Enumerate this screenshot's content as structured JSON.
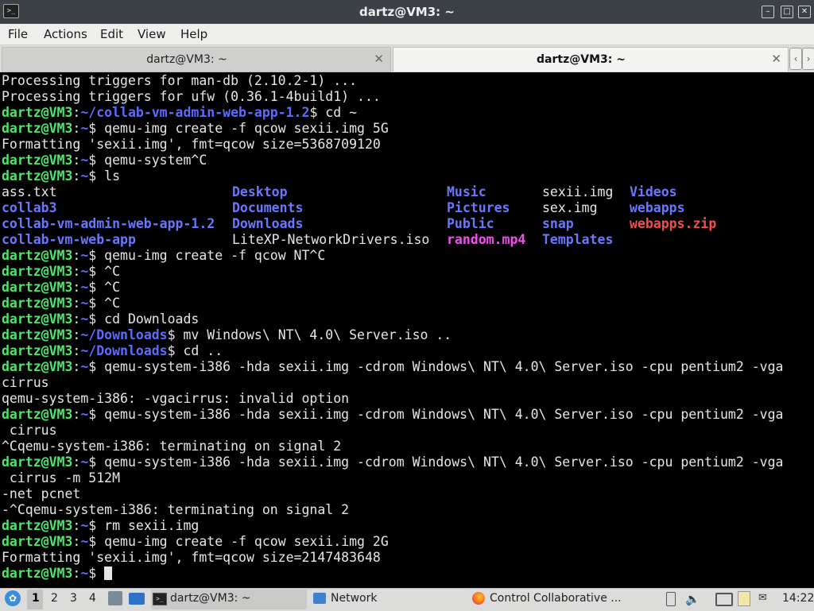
{
  "window": {
    "title": "dartz@VM3: ~",
    "icon": "terminal-icon",
    "controls": [
      "minimize-icon",
      "maximize-icon",
      "close-icon"
    ]
  },
  "menu": [
    "File",
    "Actions",
    "Edit",
    "View",
    "Help"
  ],
  "tabs": [
    {
      "label": "dartz@VM3: ~",
      "active": false
    },
    {
      "label": "dartz@VM3: ~",
      "active": true
    }
  ],
  "terminal": {
    "lines": [
      {
        "segs": [
          {
            "t": "Processing triggers for man-db (2.10.2-1) ...",
            "c": "plain"
          }
        ]
      },
      {
        "segs": [
          {
            "t": "Processing triggers for ufw (0.36.1-4build1) ...",
            "c": "plain"
          }
        ]
      },
      {
        "segs": [
          {
            "t": "dartz@VM3",
            "c": "user"
          },
          {
            "t": ":",
            "c": "plain"
          },
          {
            "t": "~/collab-vm-admin-web-app-1.2",
            "c": "path"
          },
          {
            "t": "$ cd ~",
            "c": "plain"
          }
        ]
      },
      {
        "segs": [
          {
            "t": "dartz@VM3",
            "c": "user"
          },
          {
            "t": ":",
            "c": "plain"
          },
          {
            "t": "~",
            "c": "path"
          },
          {
            "t": "$ qemu-img create -f qcow sexii.img 5G",
            "c": "plain"
          }
        ]
      },
      {
        "segs": [
          {
            "t": "Formatting 'sexii.img', fmt=qcow size=5368709120",
            "c": "plain"
          }
        ]
      },
      {
        "segs": [
          {
            "t": "dartz@VM3",
            "c": "user"
          },
          {
            "t": ":",
            "c": "plain"
          },
          {
            "t": "~",
            "c": "path"
          },
          {
            "t": "$ qemu-system^C",
            "c": "plain"
          }
        ]
      },
      {
        "segs": [
          {
            "t": "dartz@VM3",
            "c": "user"
          },
          {
            "t": ":",
            "c": "plain"
          },
          {
            "t": "~",
            "c": "path"
          },
          {
            "t": "$ ls",
            "c": "plain"
          }
        ]
      },
      {
        "ls": true
      },
      {
        "ls": true
      },
      {
        "ls": true
      },
      {
        "ls": true
      },
      {
        "segs": [
          {
            "t": "dartz@VM3",
            "c": "user"
          },
          {
            "t": ":",
            "c": "plain"
          },
          {
            "t": "~",
            "c": "path"
          },
          {
            "t": "$ qemu-img create -f qcow NT^C",
            "c": "plain"
          }
        ]
      },
      {
        "segs": [
          {
            "t": "dartz@VM3",
            "c": "user"
          },
          {
            "t": ":",
            "c": "plain"
          },
          {
            "t": "~",
            "c": "path"
          },
          {
            "t": "$ ^C",
            "c": "plain"
          }
        ]
      },
      {
        "segs": [
          {
            "t": "dartz@VM3",
            "c": "user"
          },
          {
            "t": ":",
            "c": "plain"
          },
          {
            "t": "~",
            "c": "path"
          },
          {
            "t": "$ ^C",
            "c": "plain"
          }
        ]
      },
      {
        "segs": [
          {
            "t": "dartz@VM3",
            "c": "user"
          },
          {
            "t": ":",
            "c": "plain"
          },
          {
            "t": "~",
            "c": "path"
          },
          {
            "t": "$ ^C",
            "c": "plain"
          }
        ]
      },
      {
        "segs": [
          {
            "t": "dartz@VM3",
            "c": "user"
          },
          {
            "t": ":",
            "c": "plain"
          },
          {
            "t": "~",
            "c": "path"
          },
          {
            "t": "$ cd Downloads",
            "c": "plain"
          }
        ]
      },
      {
        "segs": [
          {
            "t": "dartz@VM3",
            "c": "user"
          },
          {
            "t": ":",
            "c": "plain"
          },
          {
            "t": "~/Downloads",
            "c": "path"
          },
          {
            "t": "$ mv Windows\\ NT\\ 4.0\\ Server.iso ..",
            "c": "plain"
          }
        ]
      },
      {
        "segs": [
          {
            "t": "dartz@VM3",
            "c": "user"
          },
          {
            "t": ":",
            "c": "plain"
          },
          {
            "t": "~/Downloads",
            "c": "path"
          },
          {
            "t": "$ cd ..",
            "c": "plain"
          }
        ]
      },
      {
        "segs": [
          {
            "t": "dartz@VM3",
            "c": "user"
          },
          {
            "t": ":",
            "c": "plain"
          },
          {
            "t": "~",
            "c": "path"
          },
          {
            "t": "$ qemu-system-i386 -hda sexii.img -cdrom Windows\\ NT\\ 4.0\\ Server.iso -cpu pentium2 -vga",
            "c": "plain"
          }
        ]
      },
      {
        "segs": [
          {
            "t": "cirrus",
            "c": "plain"
          }
        ]
      },
      {
        "segs": [
          {
            "t": "qemu-system-i386: -vgacirrus: invalid option",
            "c": "plain"
          }
        ]
      },
      {
        "segs": [
          {
            "t": "dartz@VM3",
            "c": "user"
          },
          {
            "t": ":",
            "c": "plain"
          },
          {
            "t": "~",
            "c": "path"
          },
          {
            "t": "$ qemu-system-i386 -hda sexii.img -cdrom Windows\\ NT\\ 4.0\\ Server.iso -cpu pentium2 -vga",
            "c": "plain"
          }
        ]
      },
      {
        "segs": [
          {
            "t": " cirrus",
            "c": "plain"
          }
        ]
      },
      {
        "segs": [
          {
            "t": "^Cqemu-system-i386: terminating on signal 2",
            "c": "plain"
          }
        ]
      },
      {
        "segs": [
          {
            "t": "dartz@VM3",
            "c": "user"
          },
          {
            "t": ":",
            "c": "plain"
          },
          {
            "t": "~",
            "c": "path"
          },
          {
            "t": "$ qemu-system-i386 -hda sexii.img -cdrom Windows\\ NT\\ 4.0\\ Server.iso -cpu pentium2 -vga",
            "c": "plain"
          }
        ]
      },
      {
        "segs": [
          {
            "t": " cirrus -m 512M",
            "c": "plain"
          }
        ]
      },
      {
        "segs": [
          {
            "t": "-net pcnet",
            "c": "plain"
          }
        ]
      },
      {
        "segs": [
          {
            "t": "-^Cqemu-system-i386: terminating on signal 2",
            "c": "plain"
          }
        ]
      },
      {
        "segs": [
          {
            "t": "dartz@VM3",
            "c": "user"
          },
          {
            "t": ":",
            "c": "plain"
          },
          {
            "t": "~",
            "c": "path"
          },
          {
            "t": "$ rm sexii.img",
            "c": "plain"
          }
        ]
      },
      {
        "segs": [
          {
            "t": "dartz@VM3",
            "c": "user"
          },
          {
            "t": ":",
            "c": "plain"
          },
          {
            "t": "~",
            "c": "path"
          },
          {
            "t": "$ qemu-img create -f qcow sexii.img 2G",
            "c": "plain"
          }
        ]
      },
      {
        "segs": [
          {
            "t": "Formatting 'sexii.img', fmt=qcow size=2147483648",
            "c": "plain"
          }
        ]
      },
      {
        "segs": [
          {
            "t": "dartz@VM3",
            "c": "user"
          },
          {
            "t": ":",
            "c": "plain"
          },
          {
            "t": "~",
            "c": "path"
          },
          {
            "t": "$ ",
            "c": "plain"
          }
        ],
        "cursor": true
      }
    ],
    "ls_listing": [
      [
        {
          "t": "ass.txt",
          "c": "plain"
        },
        {
          "t": "Desktop",
          "c": "dir"
        },
        {
          "t": "Music",
          "c": "dir"
        },
        {
          "t": "sexii.img",
          "c": "plain"
        },
        {
          "t": "Videos",
          "c": "dir"
        }
      ],
      [
        {
          "t": "collab3",
          "c": "dir"
        },
        {
          "t": "Documents",
          "c": "dir"
        },
        {
          "t": "Pictures",
          "c": "dir"
        },
        {
          "t": "sex.img",
          "c": "plain"
        },
        {
          "t": "webapps",
          "c": "dir"
        }
      ],
      [
        {
          "t": "collab-vm-admin-web-app-1.2",
          "c": "dir"
        },
        {
          "t": "Downloads",
          "c": "dir"
        },
        {
          "t": "Public",
          "c": "dir"
        },
        {
          "t": "snap",
          "c": "dir"
        },
        {
          "t": "webapps.zip",
          "c": "red"
        }
      ],
      [
        {
          "t": "collab-vm-web-app",
          "c": "dir"
        },
        {
          "t": "LiteXP-NetworkDrivers.iso",
          "c": "plain"
        },
        {
          "t": "random.mp4",
          "c": "mag"
        },
        {
          "t": "Templates",
          "c": "dir"
        }
      ]
    ]
  },
  "taskbar": {
    "workspaces": [
      "1",
      "2",
      "3",
      "4"
    ],
    "active_workspace": "1",
    "tasks": [
      {
        "label": "dartz@VM3: ~",
        "icon": "terminal-icon"
      },
      {
        "label": "Network",
        "icon": "folder-icon"
      },
      {
        "label": "Control Collaborative ...",
        "icon": "firefox-icon"
      }
    ],
    "clock": "14:22"
  },
  "colors": {
    "user": "#4ee66a",
    "path": "#5c6cff",
    "archive": "#ef4f4f",
    "media": "#ef4fef"
  }
}
